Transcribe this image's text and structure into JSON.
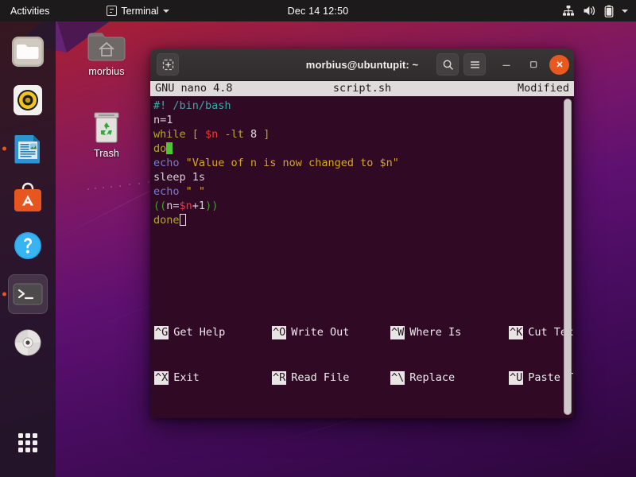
{
  "topbar": {
    "activities": "Activities",
    "app_menu": "Terminal",
    "app_icon": "terminal-icon",
    "clock": "Dec 14  12:50",
    "indicators": [
      "network-wired-icon",
      "volume-icon",
      "battery-icon",
      "chevron-down-icon"
    ]
  },
  "dock": {
    "items": [
      {
        "name": "files",
        "label": "Files",
        "icon": "folder-icon",
        "running": false,
        "active": false
      },
      {
        "name": "rhythmbox",
        "label": "Rhythmbox",
        "icon": "music-speaker-icon",
        "running": false,
        "active": false
      },
      {
        "name": "libreoffice-writer",
        "label": "LibreOffice Writer",
        "icon": "document-icon",
        "running": true,
        "active": false
      },
      {
        "name": "ubuntu-software",
        "label": "Ubuntu Software",
        "icon": "software-bag-icon",
        "running": false,
        "active": false
      },
      {
        "name": "help",
        "label": "Help",
        "icon": "question-mark-icon",
        "running": false,
        "active": false
      },
      {
        "name": "terminal",
        "label": "Terminal",
        "icon": "terminal-prompt-icon",
        "running": true,
        "active": true
      },
      {
        "name": "cd-drive",
        "label": "CD/DVD Drive",
        "icon": "optical-disc-icon",
        "running": false,
        "active": false
      }
    ],
    "show_apps": {
      "label": "Show Applications",
      "icon": "grid-nine-dots-icon"
    }
  },
  "desktop_icons": [
    {
      "name": "home-folder",
      "label": "morbius",
      "icon": "home-folder-icon"
    },
    {
      "name": "trash",
      "label": "Trash",
      "icon": "trash-recycle-icon"
    }
  ],
  "terminal": {
    "title": "morbius@ubuntupit: ~",
    "buttons": {
      "new_tab": "new-tab-icon",
      "search": "search-icon",
      "menu": "hamburger-menu-icon",
      "minimize": "minimize-icon",
      "maximize": "maximize-icon",
      "close": "close-icon"
    }
  },
  "nano": {
    "version": "GNU nano 4.8",
    "filename": "script.sh",
    "status": "Modified",
    "lines": [
      [
        {
          "t": "#! /bin/bash",
          "c": "c-shebang"
        }
      ],
      [
        {
          "t": "n=1",
          "c": "c-plain"
        }
      ],
      [
        {
          "t": "while ",
          "c": "c-kw"
        },
        {
          "t": "[ ",
          "c": "c-kw"
        },
        {
          "t": "$n",
          "c": "c-var"
        },
        {
          "t": " -lt ",
          "c": "c-kw"
        },
        {
          "t": "8",
          "c": "c-num"
        },
        {
          "t": " ]",
          "c": "c-kw"
        }
      ],
      [
        {
          "t": "do",
          "c": "c-kw"
        },
        {
          "t": "",
          "c": "cursor-block"
        }
      ],
      [
        {
          "t": "echo ",
          "c": "c-cmd"
        },
        {
          "t": "\"Value of n is now changed to $n\"",
          "c": "c-str"
        }
      ],
      [
        {
          "t": "sleep 1s",
          "c": "c-plain"
        }
      ],
      [
        {
          "t": "echo ",
          "c": "c-cmd"
        },
        {
          "t": "\" \"",
          "c": "c-str"
        }
      ],
      [
        {
          "t": "((",
          "c": "c-paren"
        },
        {
          "t": "n=",
          "c": "c-plain"
        },
        {
          "t": "$n",
          "c": "c-var"
        },
        {
          "t": "+1",
          "c": "c-plain"
        },
        {
          "t": "))",
          "c": "c-paren"
        }
      ],
      [
        {
          "t": "done",
          "c": "c-kw"
        },
        {
          "t": "",
          "c": "cursor-hollow"
        }
      ]
    ],
    "shortcuts_row1": [
      {
        "key": "^G",
        "label": "Get Help"
      },
      {
        "key": "^O",
        "label": "Write Out"
      },
      {
        "key": "^W",
        "label": "Where Is"
      },
      {
        "key": "^K",
        "label": "Cut Text"
      }
    ],
    "shortcuts_row2": [
      {
        "key": "^X",
        "label": "Exit"
      },
      {
        "key": "^R",
        "label": "Read File"
      },
      {
        "key": "^\\",
        "label": "Replace"
      },
      {
        "key": "^U",
        "label": "Paste Text"
      }
    ]
  },
  "colors": {
    "terminal_bg": "#300a24",
    "accent_orange": "#e8581f",
    "topbar_bg": "#1c1a1b"
  }
}
